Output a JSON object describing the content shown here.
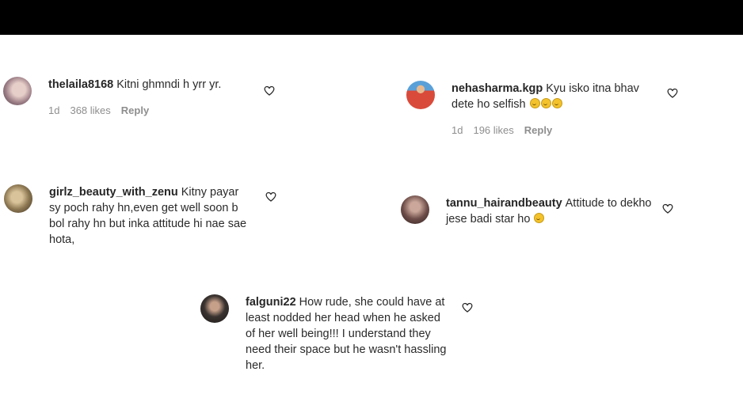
{
  "comments": [
    {
      "username": "thelaila8168",
      "text": "Kitni ghmndi h yrr yr.",
      "time": "1d",
      "likes": "368 likes",
      "reply": "Reply",
      "avatar_color": "#b99aa3",
      "emojis": 0
    },
    {
      "username": "nehasharma.kgp",
      "text": "Kyu isko itna bhav dete ho selfish",
      "time": "1d",
      "likes": "196 likes",
      "reply": "Reply",
      "avatar_color": "#d94a3a",
      "emojis": 3
    },
    {
      "username": "girlz_beauty_with_zenu",
      "text": "Kitny payar sy poch rahy hn,even get well soon b bol rahy hn but inka attitude hi nae sae hota,",
      "avatar_color": "#7a6a4e",
      "emojis": 0
    },
    {
      "username": "tannu_hairandbeauty",
      "text": "Attitude to dekho jese badi star ho",
      "avatar_color": "#6d4c48",
      "emojis": 1
    },
    {
      "username": "falguni22",
      "text": "How rude, she could have at least nodded her head when he asked of her well being!!! I understand they need their space but he wasn't hassling her.",
      "avatar_color": "#3a3330",
      "emojis": 0
    }
  ],
  "icons": {
    "like": "heart-outline-icon",
    "emoji": "smiling-face-emoji-icon"
  },
  "colors": {
    "top_bar": "#000000",
    "text": "#262626",
    "meta": "#8e8e8e"
  }
}
